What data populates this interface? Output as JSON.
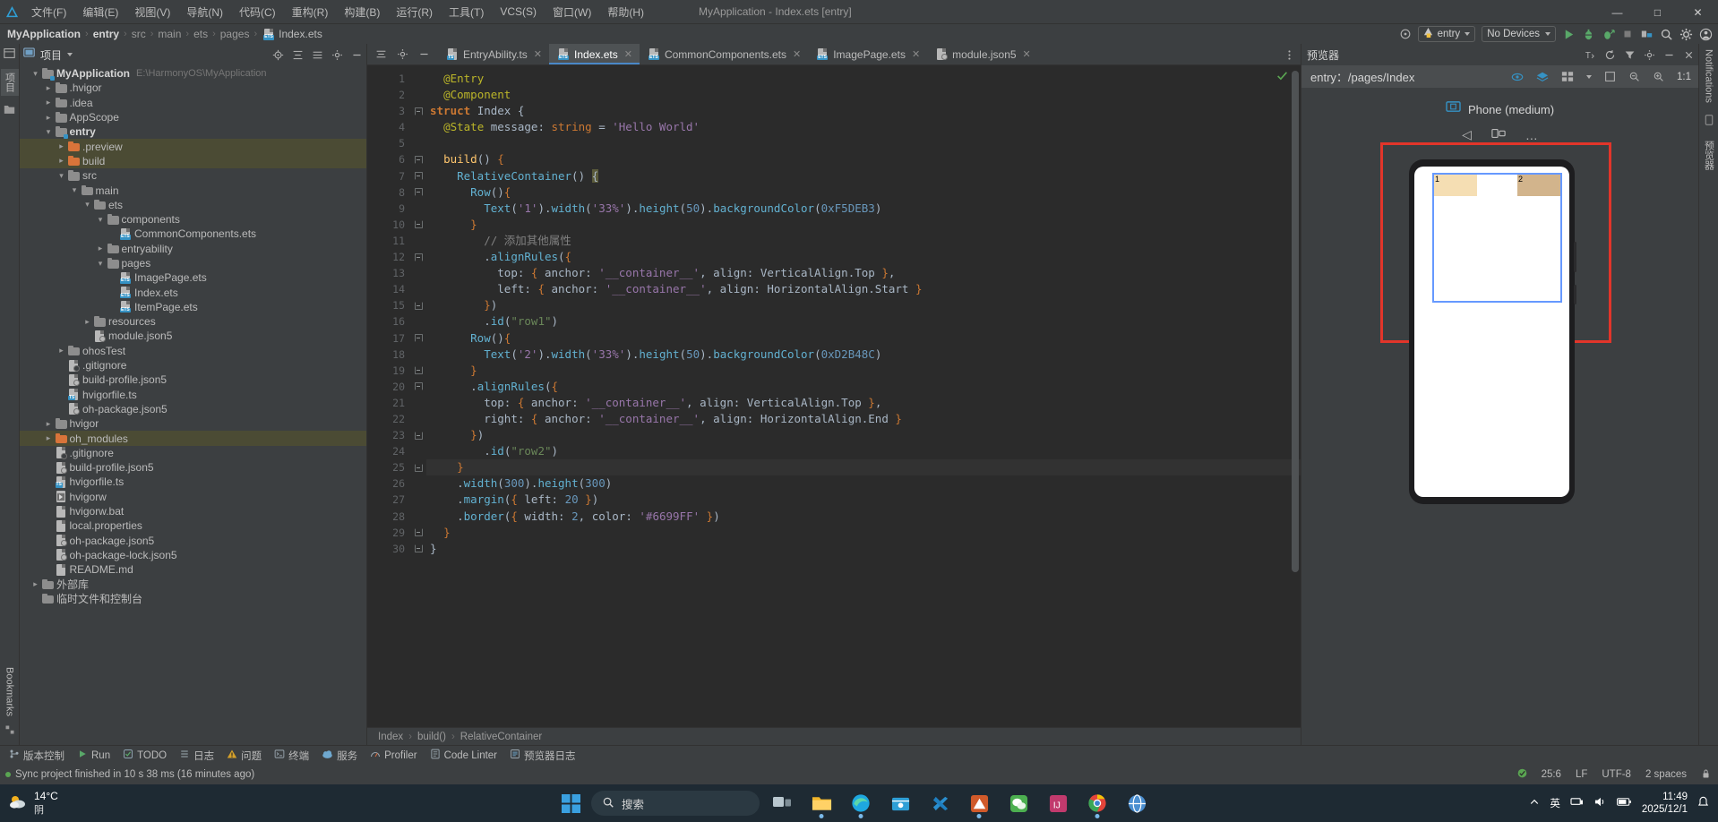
{
  "window": {
    "app_title": "MyApplication - Index.ets [entry]",
    "minimize": "—",
    "maximize": "□",
    "close": "✕"
  },
  "menubar": {
    "items": [
      {
        "label": "文件(F)",
        "name": "menu-file"
      },
      {
        "label": "编辑(E)",
        "name": "menu-edit"
      },
      {
        "label": "视图(V)",
        "name": "menu-view"
      },
      {
        "label": "导航(N)",
        "name": "menu-navigate"
      },
      {
        "label": "代码(C)",
        "name": "menu-code"
      },
      {
        "label": "重构(R)",
        "name": "menu-refactor"
      },
      {
        "label": "构建(B)",
        "name": "menu-build"
      },
      {
        "label": "运行(R)",
        "name": "menu-run"
      },
      {
        "label": "工具(T)",
        "name": "menu-tools"
      },
      {
        "label": "VCS(S)",
        "name": "menu-vcs"
      },
      {
        "label": "窗口(W)",
        "name": "menu-window"
      },
      {
        "label": "帮助(H)",
        "name": "menu-help"
      }
    ]
  },
  "breadcrumb": {
    "items": [
      "MyApplication",
      "entry",
      "src",
      "main",
      "ets",
      "pages"
    ],
    "file": "Index.ets",
    "separator": "›"
  },
  "toolbar": {
    "run_config": "entry",
    "device": "No Devices",
    "run_tooltip": "Run",
    "debug_tooltip": "Debug",
    "profile_tooltip": "Profile",
    "stop_tooltip": "Stop",
    "search_tooltip": "Search",
    "settings_tooltip": "Settings",
    "account_tooltip": "Account"
  },
  "project_panel": {
    "title": "项目",
    "tree": [
      {
        "depth": 0,
        "arrow": "down",
        "icon": "folder-mod",
        "label": "MyApplication",
        "sub": "E:\\HarmonyOS\\MyApplication",
        "bold": true,
        "hl": false
      },
      {
        "depth": 1,
        "arrow": "right",
        "icon": "folder",
        "label": ".hvigor",
        "sub": "",
        "bold": false,
        "hl": false
      },
      {
        "depth": 1,
        "arrow": "right",
        "icon": "folder",
        "label": ".idea",
        "sub": "",
        "bold": false,
        "hl": false
      },
      {
        "depth": 1,
        "arrow": "right",
        "icon": "folder",
        "label": "AppScope",
        "sub": "",
        "bold": false,
        "hl": false
      },
      {
        "depth": 1,
        "arrow": "down",
        "icon": "folder-mod",
        "label": "entry",
        "sub": "",
        "bold": true,
        "hl": false
      },
      {
        "depth": 2,
        "arrow": "right",
        "icon": "folder-orange",
        "label": ".preview",
        "sub": "",
        "bold": false,
        "hl": true
      },
      {
        "depth": 2,
        "arrow": "right",
        "icon": "folder-orange",
        "label": "build",
        "sub": "",
        "bold": false,
        "hl": true
      },
      {
        "depth": 2,
        "arrow": "down",
        "icon": "folder",
        "label": "src",
        "sub": "",
        "bold": false,
        "hl": false
      },
      {
        "depth": 3,
        "arrow": "down",
        "icon": "folder",
        "label": "main",
        "sub": "",
        "bold": false,
        "hl": false
      },
      {
        "depth": 4,
        "arrow": "down",
        "icon": "folder",
        "label": "ets",
        "sub": "",
        "bold": false,
        "hl": false
      },
      {
        "depth": 5,
        "arrow": "down",
        "icon": "folder",
        "label": "components",
        "sub": "",
        "bold": false,
        "hl": false
      },
      {
        "depth": 6,
        "arrow": "none",
        "icon": "ets",
        "label": "CommonComponents.ets",
        "sub": "",
        "bold": false,
        "hl": false
      },
      {
        "depth": 5,
        "arrow": "right",
        "icon": "folder",
        "label": "entryability",
        "sub": "",
        "bold": false,
        "hl": false
      },
      {
        "depth": 5,
        "arrow": "down",
        "icon": "folder",
        "label": "pages",
        "sub": "",
        "bold": false,
        "hl": false
      },
      {
        "depth": 6,
        "arrow": "none",
        "icon": "ets",
        "label": "ImagePage.ets",
        "sub": "",
        "bold": false,
        "hl": false
      },
      {
        "depth": 6,
        "arrow": "none",
        "icon": "ets",
        "label": "Index.ets",
        "sub": "",
        "bold": false,
        "hl": false
      },
      {
        "depth": 6,
        "arrow": "none",
        "icon": "ets",
        "label": "ItemPage.ets",
        "sub": "",
        "bold": false,
        "hl": false
      },
      {
        "depth": 4,
        "arrow": "right",
        "icon": "folder",
        "label": "resources",
        "sub": "",
        "bold": false,
        "hl": false
      },
      {
        "depth": 4,
        "arrow": "none",
        "icon": "json",
        "label": "module.json5",
        "sub": "",
        "bold": false,
        "hl": false
      },
      {
        "depth": 2,
        "arrow": "right",
        "icon": "folder",
        "label": "ohosTest",
        "sub": "",
        "bold": false,
        "hl": false
      },
      {
        "depth": 2,
        "arrow": "none",
        "icon": "gitign",
        "label": ".gitignore",
        "sub": "",
        "bold": false,
        "hl": false
      },
      {
        "depth": 2,
        "arrow": "none",
        "icon": "json",
        "label": "build-profile.json5",
        "sub": "",
        "bold": false,
        "hl": false
      },
      {
        "depth": 2,
        "arrow": "none",
        "icon": "ts",
        "label": "hvigorfile.ts",
        "sub": "",
        "bold": false,
        "hl": false
      },
      {
        "depth": 2,
        "arrow": "none",
        "icon": "json",
        "label": "oh-package.json5",
        "sub": "",
        "bold": false,
        "hl": false
      },
      {
        "depth": 1,
        "arrow": "right",
        "icon": "folder",
        "label": "hvigor",
        "sub": "",
        "bold": false,
        "hl": false
      },
      {
        "depth": 1,
        "arrow": "right",
        "icon": "folder-orange",
        "label": "oh_modules",
        "sub": "",
        "bold": false,
        "hl": true
      },
      {
        "depth": 1,
        "arrow": "none",
        "icon": "gitign",
        "label": ".gitignore",
        "sub": "",
        "bold": false,
        "hl": false
      },
      {
        "depth": 1,
        "arrow": "none",
        "icon": "json",
        "label": "build-profile.json5",
        "sub": "",
        "bold": false,
        "hl": false
      },
      {
        "depth": 1,
        "arrow": "none",
        "icon": "ts",
        "label": "hvigorfile.ts",
        "sub": "",
        "bold": false,
        "hl": false
      },
      {
        "depth": 1,
        "arrow": "none",
        "icon": "script",
        "label": "hvigorw",
        "sub": "",
        "bold": false,
        "hl": false
      },
      {
        "depth": 1,
        "arrow": "none",
        "icon": "props",
        "label": "hvigorw.bat",
        "sub": "",
        "bold": false,
        "hl": false
      },
      {
        "depth": 1,
        "arrow": "none",
        "icon": "props",
        "label": "local.properties",
        "sub": "",
        "bold": false,
        "hl": false
      },
      {
        "depth": 1,
        "arrow": "none",
        "icon": "json",
        "label": "oh-package.json5",
        "sub": "",
        "bold": false,
        "hl": false
      },
      {
        "depth": 1,
        "arrow": "none",
        "icon": "json",
        "label": "oh-package-lock.json5",
        "sub": "",
        "bold": false,
        "hl": false
      },
      {
        "depth": 1,
        "arrow": "none",
        "icon": "md",
        "label": "README.md",
        "sub": "",
        "bold": false,
        "hl": false
      },
      {
        "depth": 0,
        "arrow": "right",
        "icon": "folder",
        "label": "外部库",
        "sub": "",
        "bold": false,
        "hl": false
      },
      {
        "depth": 0,
        "arrow": "none",
        "icon": "folder",
        "label": "临时文件和控制台",
        "sub": "",
        "bold": false,
        "hl": false
      }
    ]
  },
  "left_rail": {
    "project_tab": "项目",
    "bookmarks_tab": "Bookmarks",
    "structure_tab": "结构"
  },
  "right_rail": {
    "notifications": "Notifications",
    "previewer": "预览器"
  },
  "editor": {
    "tabs": [
      {
        "label": "EntryAbility.ts",
        "icon": "ts",
        "active": false
      },
      {
        "label": "Index.ets",
        "icon": "ets",
        "active": true
      },
      {
        "label": "CommonComponents.ets",
        "icon": "ets",
        "active": false
      },
      {
        "label": "ImagePage.ets",
        "icon": "ets",
        "active": false
      },
      {
        "label": "module.json5",
        "icon": "json",
        "active": false
      }
    ],
    "close_glyph": "✕",
    "lines": [
      {
        "n": 1,
        "html": "  <span class='ann'>@Entry</span>"
      },
      {
        "n": 2,
        "html": "  <span class='ann'>@Component</span>"
      },
      {
        "n": 3,
        "html": "<span class='kw'>struct</span> <span class='cls'>Index</span> <span class='brace'>{</span>"
      },
      {
        "n": 4,
        "html": "  <span class='ann'>@State</span> <span class='id'>message</span><span class='brace'>:</span> <span class='orange'>string</span> <span class='brace'>=</span> <span class='strp'>'Hello World'</span>"
      },
      {
        "n": 5,
        "html": ""
      },
      {
        "n": 6,
        "html": "  <span class='fn'>build</span><span class='brace'>()</span> <span class='orange'>{</span>"
      },
      {
        "n": 7,
        "html": "    <span class='mth'>RelativeContainer</span><span class='brace'>()</span> <span class='cursorblk'>{</span>"
      },
      {
        "n": 8,
        "html": "      <span class='mth'>Row</span><span class='brace'>()</span><span class='orange'>{</span>"
      },
      {
        "n": 9,
        "html": "        <span class='mth'>Text</span><span class='brace'>(</span><span class='strp'>'1'</span><span class='brace'>)</span><span class='brace'>.</span><span class='mth'>width</span><span class='brace'>(</span><span class='strp'>'33%'</span><span class='brace'>)</span><span class='brace'>.</span><span class='mth'>height</span><span class='brace'>(</span><span class='num'>50</span><span class='brace'>)</span><span class='brace'>.</span><span class='mth'>backgroundColor</span><span class='brace'>(</span><span class='num'>0xF5DEB3</span><span class='brace'>)</span>"
      },
      {
        "n": 10,
        "html": "      <span class='orange'>}</span>"
      },
      {
        "n": 11,
        "html": "        <span class='cmt'>// 添加其他属性</span>"
      },
      {
        "n": 12,
        "html": "        <span class='brace'>.</span><span class='mth'>alignRules</span><span class='brace'>(</span><span class='orange'>{</span>"
      },
      {
        "n": 13,
        "html": "          <span class='id'>top</span><span class='brace'>:</span> <span class='orange'>{</span> <span class='id'>anchor</span><span class='brace'>:</span> <span class='strp'>'__container__'</span><span class='brace'>,</span> <span class='id'>align</span><span class='brace'>:</span> <span class='cls'>VerticalAlign</span><span class='brace'>.</span><span class='id'>Top</span> <span class='orange'>}</span><span class='brace'>,</span>"
      },
      {
        "n": 14,
        "html": "          <span class='id'>left</span><span class='brace'>:</span> <span class='orange'>{</span> <span class='id'>anchor</span><span class='brace'>:</span> <span class='strp'>'__container__'</span><span class='brace'>,</span> <span class='id'>align</span><span class='brace'>:</span> <span class='cls'>HorizontalAlign</span><span class='brace'>.</span><span class='id'>Start</span> <span class='orange'>}</span>"
      },
      {
        "n": 15,
        "html": "        <span class='orange'>}</span><span class='brace'>)</span>"
      },
      {
        "n": 16,
        "html": "        <span class='brace'>.</span><span class='mth'>id</span><span class='brace'>(</span><span class='str'>\"row1\"</span><span class='brace'>)</span>"
      },
      {
        "n": 17,
        "html": "      <span class='mth'>Row</span><span class='brace'>()</span><span class='orange'>{</span>"
      },
      {
        "n": 18,
        "html": "        <span class='mth'>Text</span><span class='brace'>(</span><span class='strp'>'2'</span><span class='brace'>)</span><span class='brace'>.</span><span class='mth'>width</span><span class='brace'>(</span><span class='strp'>'33%'</span><span class='brace'>)</span><span class='brace'>.</span><span class='mth'>height</span><span class='brace'>(</span><span class='num'>50</span><span class='brace'>)</span><span class='brace'>.</span><span class='mth'>backgroundColor</span><span class='brace'>(</span><span class='num'>0xD2B48C</span><span class='brace'>)</span>"
      },
      {
        "n": 19,
        "html": "      <span class='orange'>}</span>"
      },
      {
        "n": 20,
        "html": "      <span class='brace'>.</span><span class='mth'>alignRules</span><span class='brace'>(</span><span class='orange'>{</span>"
      },
      {
        "n": 21,
        "html": "        <span class='id'>top</span><span class='brace'>:</span> <span class='orange'>{</span> <span class='id'>anchor</span><span class='brace'>:</span> <span class='strp'>'__container__'</span><span class='brace'>,</span> <span class='id'>align</span><span class='brace'>:</span> <span class='cls'>VerticalAlign</span><span class='brace'>.</span><span class='id'>Top</span> <span class='orange'>}</span><span class='brace'>,</span>"
      },
      {
        "n": 22,
        "html": "        <span class='id'>right</span><span class='brace'>:</span> <span class='orange'>{</span> <span class='id'>anchor</span><span class='brace'>:</span> <span class='strp'>'__container__'</span><span class='brace'>,</span> <span class='id'>align</span><span class='brace'>:</span> <span class='cls'>HorizontalAlign</span><span class='brace'>.</span><span class='id'>End</span> <span class='orange'>}</span>"
      },
      {
        "n": 23,
        "html": "      <span class='orange'>}</span><span class='brace'>)</span>"
      },
      {
        "n": 24,
        "html": "        <span class='brace'>.</span><span class='mth'>id</span><span class='brace'>(</span><span class='str'>\"row2\"</span><span class='brace'>)</span>"
      },
      {
        "n": 25,
        "html": "    <span class='orange'>}</span>"
      },
      {
        "n": 26,
        "html": "    <span class='brace'>.</span><span class='mth'>width</span><span class='brace'>(</span><span class='num'>300</span><span class='brace'>)</span><span class='brace'>.</span><span class='mth'>height</span><span class='brace'>(</span><span class='num'>300</span><span class='brace'>)</span>"
      },
      {
        "n": 27,
        "html": "    <span class='brace'>.</span><span class='mth'>margin</span><span class='brace'>(</span><span class='orange'>{</span> <span class='id'>left</span><span class='brace'>:</span> <span class='num'>20</span> <span class='orange'>}</span><span class='brace'>)</span>"
      },
      {
        "n": 28,
        "html": "    <span class='brace'>.</span><span class='mth'>border</span><span class='brace'>(</span><span class='orange'>{</span> <span class='id'>width</span><span class='brace'>:</span> <span class='num'>2</span><span class='brace'>,</span> <span class='id'>color</span><span class='brace'>:</span> <span class='strp'>'#6699FF'</span> <span class='orange'>}</span><span class='brace'>)</span>"
      },
      {
        "n": 29,
        "html": "  <span class='orange'>}</span>"
      },
      {
        "n": 30,
        "html": "<span class='brace'>}</span>"
      }
    ],
    "structure_crumbs": [
      "Index",
      "build()",
      "RelativeContainer"
    ],
    "crumb_sep": "›"
  },
  "previewer": {
    "title": "预览器",
    "path": "entry：/pages/Index",
    "device_label": "Phone (medium)",
    "zoom_label": "1:1",
    "ctrl_back": "◁",
    "ctrl_rotate": "↻",
    "ctrl_more": "…",
    "preview_cells": [
      {
        "label": "1",
        "color": "#F5DEB3"
      },
      {
        "label": "2",
        "color": "#D2B48C"
      }
    ],
    "container_border_color": "#6699FF",
    "selection_box_color": "#E2352A"
  },
  "tool_window_bar": {
    "items": [
      {
        "label": "版本控制",
        "name": "tool-vcs",
        "icon": "branch-icon"
      },
      {
        "label": "Run",
        "name": "tool-run",
        "icon": "play-icon"
      },
      {
        "label": "TODO",
        "name": "tool-todo",
        "icon": "check-icon"
      },
      {
        "label": "日志",
        "name": "tool-log",
        "icon": "list-icon"
      },
      {
        "label": "问题",
        "name": "tool-problems",
        "icon": "warning-icon"
      },
      {
        "label": "终端",
        "name": "tool-terminal",
        "icon": "terminal-icon"
      },
      {
        "label": "服务",
        "name": "tool-services",
        "icon": "cloud-icon"
      },
      {
        "label": "Profiler",
        "name": "tool-profiler",
        "icon": "gauge-icon"
      },
      {
        "label": "Code Linter",
        "name": "tool-code-linter",
        "icon": "lint-icon"
      },
      {
        "label": "预览器日志",
        "name": "tool-previewer-log",
        "icon": "log-icon"
      }
    ]
  },
  "status_bar": {
    "message": "Sync project finished in 10 s 38 ms (16 minutes ago)",
    "caret": "25:6",
    "line_ending": "LF",
    "encoding": "UTF-8",
    "indent": "2 spaces",
    "git_branch": ""
  },
  "taskbar": {
    "weather_temp": "14°C",
    "weather_desc": "阴",
    "search_placeholder": "搜索",
    "clock_time": "11:49",
    "clock_date": "2025/12/1",
    "ime": "英",
    "apps": [
      {
        "name": "task-view",
        "label": "任务视图"
      },
      {
        "name": "file-explorer",
        "label": "文件资源管理器"
      },
      {
        "name": "edge-browser",
        "label": "Microsoft Edge"
      },
      {
        "name": "store",
        "label": "Microsoft Store"
      },
      {
        "name": "vscode",
        "label": "Visual Studio Code"
      },
      {
        "name": "deveco-studio",
        "label": "DevEco Studio"
      },
      {
        "name": "wechat-dev",
        "label": "微信开发者工具"
      },
      {
        "name": "idea",
        "label": "IntelliJ IDEA"
      },
      {
        "name": "chrome",
        "label": "Google Chrome"
      },
      {
        "name": "browser2",
        "label": "浏览器"
      }
    ]
  }
}
